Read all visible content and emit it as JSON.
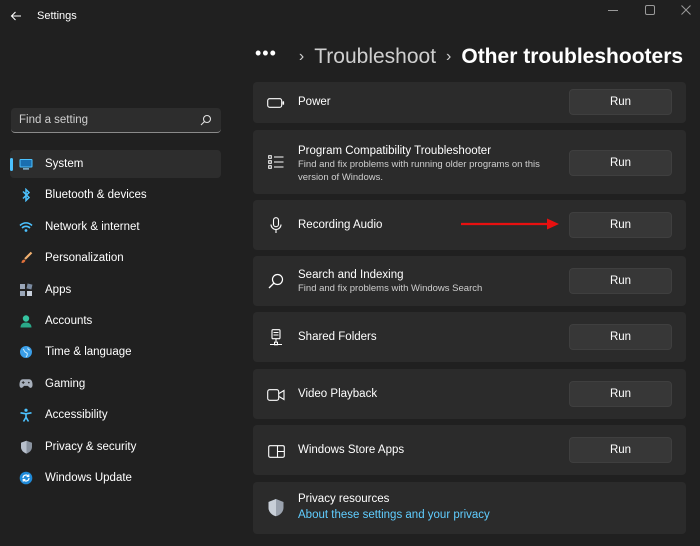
{
  "window": {
    "title": "Settings",
    "controls": [
      "minimize-icon",
      "maximize-icon",
      "close-icon"
    ]
  },
  "sidebar": {
    "search_placeholder": "Find a setting",
    "items": [
      {
        "label": "System",
        "icon": "system-icon",
        "active": true
      },
      {
        "label": "Bluetooth & devices",
        "icon": "bluetooth-icon"
      },
      {
        "label": "Network & internet",
        "icon": "network-icon"
      },
      {
        "label": "Personalization",
        "icon": "brush-icon"
      },
      {
        "label": "Apps",
        "icon": "apps-icon"
      },
      {
        "label": "Accounts",
        "icon": "accounts-icon"
      },
      {
        "label": "Time & language",
        "icon": "globe-icon"
      },
      {
        "label": "Gaming",
        "icon": "gamepad-icon"
      },
      {
        "label": "Accessibility",
        "icon": "accessibility-icon"
      },
      {
        "label": "Privacy & security",
        "icon": "shield-icon"
      },
      {
        "label": "Windows Update",
        "icon": "update-icon"
      }
    ]
  },
  "breadcrumb": {
    "overflow": "•••",
    "parent": "Troubleshoot",
    "current": "Other troubleshooters"
  },
  "troubleshooters": [
    {
      "title": "Power",
      "desc": "",
      "icon": "battery-icon",
      "button": "Run"
    },
    {
      "title": "Program Compatibility Troubleshooter",
      "desc": "Find and fix problems with running older programs on this version of Windows.",
      "icon": "list-icon",
      "button": "Run"
    },
    {
      "title": "Recording Audio",
      "desc": "",
      "icon": "microphone-icon",
      "button": "Run"
    },
    {
      "title": "Search and Indexing",
      "desc": "Find and fix problems with Windows Search",
      "icon": "search-icon",
      "button": "Run"
    },
    {
      "title": "Shared Folders",
      "desc": "",
      "icon": "network-drive-icon",
      "button": "Run"
    },
    {
      "title": "Video Playback",
      "desc": "",
      "icon": "video-camera-icon",
      "button": "Run"
    },
    {
      "title": "Windows Store Apps",
      "desc": "",
      "icon": "store-apps-icon",
      "button": "Run"
    }
  ],
  "privacy": {
    "title": "Privacy resources",
    "link": "About these settings and your privacy",
    "icon": "shield-icon"
  },
  "colors": {
    "background": "#202020",
    "card": "#2b2b2b",
    "accent": "#4cc2ff",
    "link": "#60cdff",
    "annotation_arrow": "#e81010"
  }
}
